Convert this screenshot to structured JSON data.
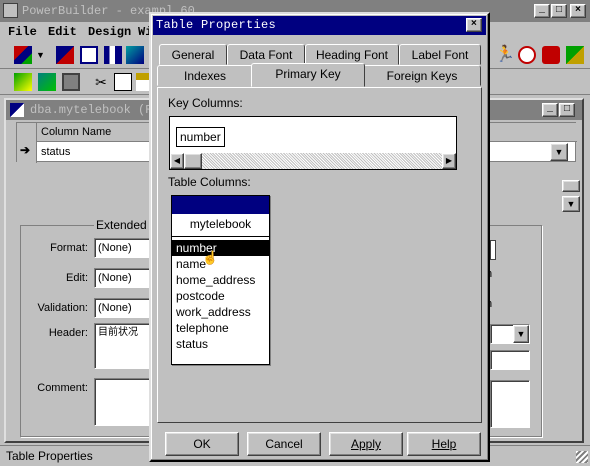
{
  "app": {
    "title": "PowerBuilder - exampl 60",
    "menu": [
      "File",
      "Edit",
      "Design",
      "Wi"
    ]
  },
  "child": {
    "title": "dba.mytelebook  (Re",
    "grid": {
      "header": "Column Name",
      "row": "status"
    },
    "ext_label": "Extended A",
    "fields": {
      "format_label": "Format:",
      "format_value": "(None)",
      "edit_label": "Edit:",
      "edit_value": "(None)",
      "validation_label": "Validation:",
      "validation_value": "(None)",
      "header_label": "Header:",
      "header_value": "目前状况",
      "comment_label": "Comment:"
    },
    "right_fragments": [
      "n",
      "n"
    ]
  },
  "dialog": {
    "title": "Table Properties",
    "tabs_row1": [
      "General",
      "Data Font",
      "Heading Font",
      "Label Font"
    ],
    "tabs_row2": [
      "Indexes",
      "Primary Key",
      "Foreign Keys"
    ],
    "key_columns_label": "Key Columns:",
    "key_column_item": "number",
    "table_columns_label": "Table Columns:",
    "table_name": "mytelebook",
    "columns": [
      "number",
      "name",
      "home_address",
      "postcode",
      "work_address",
      "telephone",
      "status"
    ],
    "selected_column": "number",
    "buttons": {
      "ok": "OK",
      "cancel": "Cancel",
      "apply": "Apply",
      "help": "Help"
    }
  },
  "statusbar": {
    "text": "Table Properties"
  },
  "colors": {
    "titlebar_active": "#000080",
    "titlebar_inactive": "#808080",
    "face": "#c0c0c0"
  }
}
